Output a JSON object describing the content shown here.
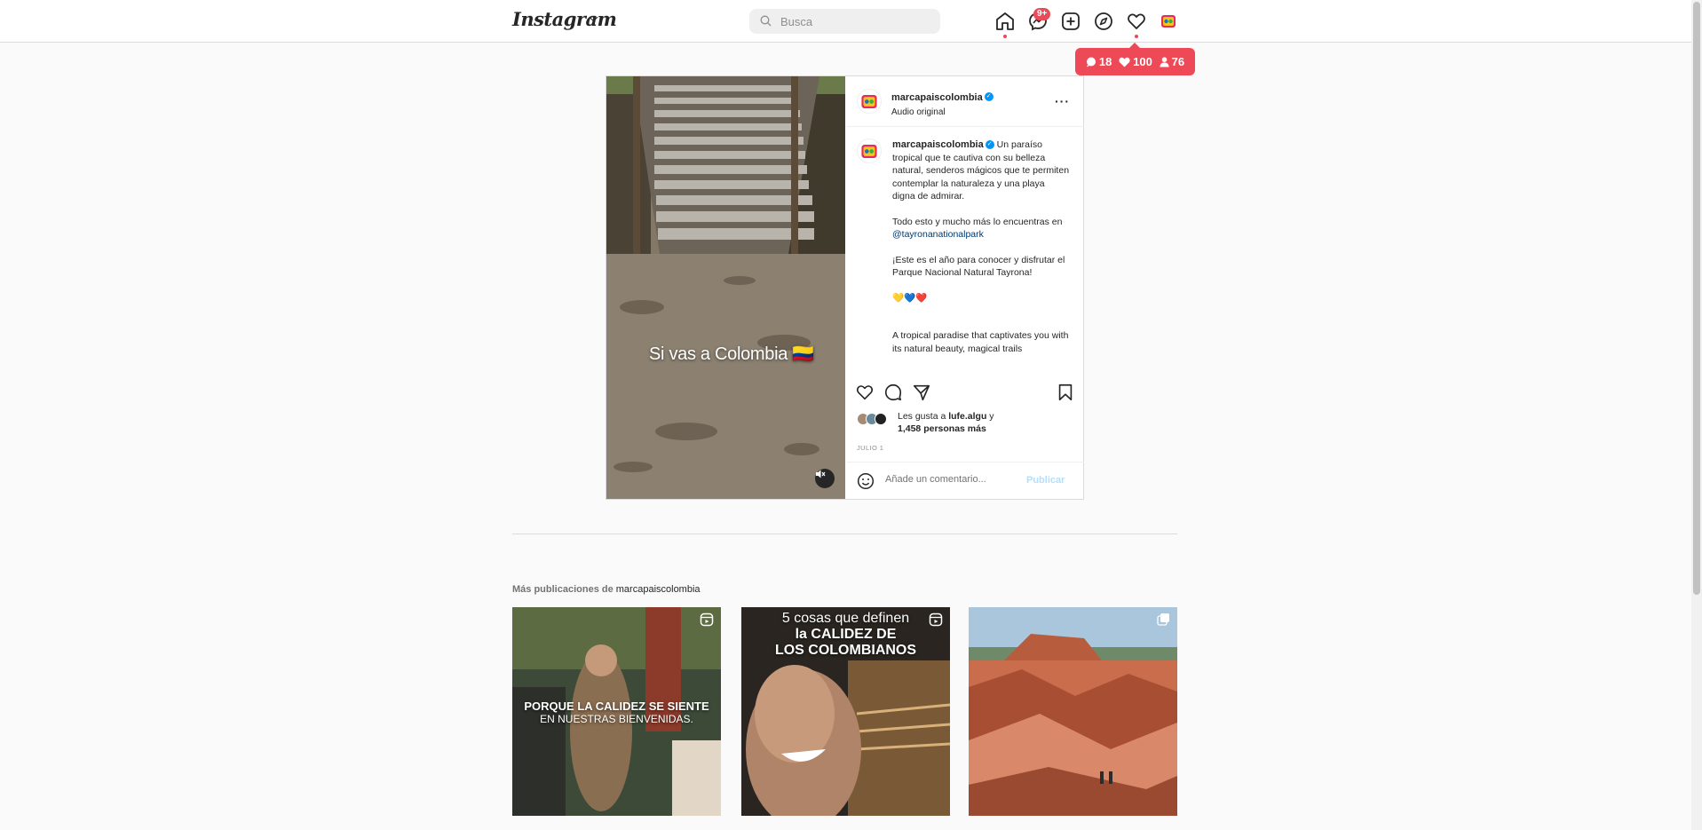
{
  "header": {
    "logo_text": "Instagram",
    "search_placeholder": "Busca",
    "messages_badge": "9+"
  },
  "notification_popup": {
    "comments": "18",
    "likes": "100",
    "follows": "76"
  },
  "post": {
    "username": "marcapaiscolombia",
    "audio": "Audio original",
    "video_overlay_text": "Si vas a Colombia 🇨🇴",
    "caption": {
      "username": "marcapaiscolombia",
      "paragraph_1": "Un paraíso tropical que te cautiva con su belleza natural, senderos mágicos que te permiten contemplar la naturaleza y una playa digna de admirar.",
      "paragraph_2_text": "Todo esto y mucho más lo encuentras en ",
      "paragraph_2_mention": "@tayronanationalpark",
      "paragraph_3": "¡Este es el año para conocer y disfrutar el Parque Nacional Natural Tayrona!",
      "emojis": "💛💙❤️",
      "paragraph_4": "A tropical paradise that captivates you with its natural beauty, magical trails"
    },
    "likes": {
      "prefix": "Les gusta a ",
      "liker": "lufe.algu",
      "connector": " y",
      "others": "1,458 personas más"
    },
    "date": "JULIO 1",
    "comment_placeholder": "Añade un comentario...",
    "publish_label": "Publicar"
  },
  "more_posts": {
    "label": "Más publicaciones de ",
    "username": "marcapaiscolombia",
    "items": [
      {
        "line1": "PORQUE LA CALIDEZ SE SIENTE",
        "line2": "EN NUESTRAS BIENVENIDAS."
      },
      {
        "line1": "5 cosas que definen",
        "line2": "la CALIDEZ DE",
        "line3": "LOS COLOMBIANOS"
      },
      {
        "line1": ""
      }
    ]
  },
  "colors": {
    "accent": "#ed4956",
    "link": "#0095f6",
    "border": "#dbdbdb"
  }
}
